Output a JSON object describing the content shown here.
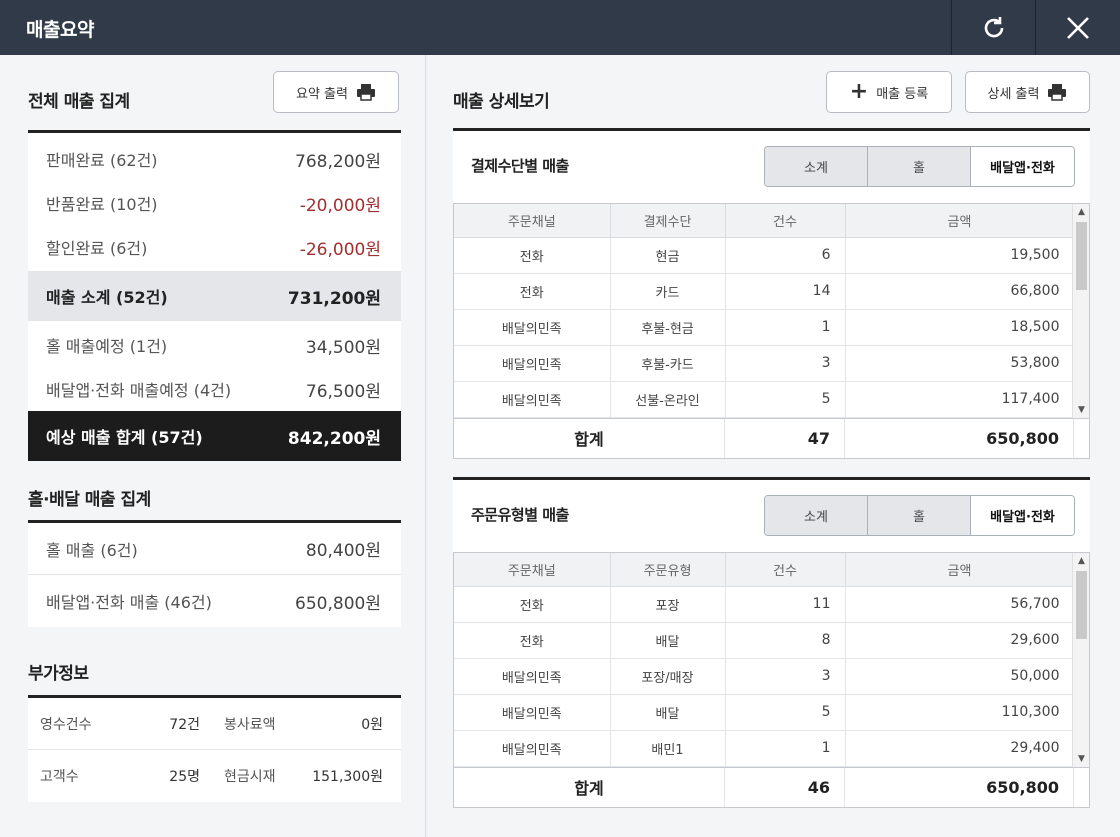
{
  "window": {
    "title": "매출요약"
  },
  "summary": {
    "title": "전체 매출 집계",
    "print_label": "요약 출력",
    "rows": [
      {
        "label": "판매완료 (62건)",
        "value": "768,200원"
      },
      {
        "label": "반품완료 (10건)",
        "value": "-20,000원"
      },
      {
        "label": "할인완료 (6건)",
        "value": "-26,000원"
      }
    ],
    "subtotal": {
      "label": "매출 소계 (52건)",
      "value": "731,200원"
    },
    "expected_rows": [
      {
        "label": "홀 매출예정 (1건)",
        "value": "34,500원"
      },
      {
        "label": "배달앱·전화 매출예정 (4건)",
        "value": "76,500원"
      }
    ],
    "total": {
      "label": "예상 매출 합계 (57건)",
      "value": "842,200원"
    }
  },
  "hall_delivery": {
    "title": "홀·배달 매출 집계",
    "rows": [
      {
        "label": "홀 매출 (6건)",
        "value": "80,400원"
      },
      {
        "label": "배달앱·전화 매출 (46건)",
        "value": "650,800원"
      }
    ]
  },
  "extra": {
    "title": "부가정보",
    "rows": [
      {
        "k1": "영수건수",
        "v1": "72건",
        "k2": "봉사료액",
        "v2": "0원"
      },
      {
        "k1": "고객수",
        "v1": "25명",
        "k2": "현금시재",
        "v2": "151,300원"
      }
    ]
  },
  "detail": {
    "title": "매출 상세보기",
    "register_label": "매출 등록",
    "print_label": "상세 출력"
  },
  "payment_panel": {
    "title": "결제수단별 매출",
    "segments": [
      "소계",
      "홀",
      "배달앱·전화"
    ],
    "headers": [
      "주문채널",
      "결제수단",
      "건수",
      "금액"
    ],
    "rows": [
      [
        "전화",
        "현금",
        "6",
        "19,500"
      ],
      [
        "전화",
        "카드",
        "14",
        "66,800"
      ],
      [
        "배달의민족",
        "후불-현금",
        "1",
        "18,500"
      ],
      [
        "배달의민족",
        "후불-카드",
        "3",
        "53,800"
      ],
      [
        "배달의민족",
        "선불-온라인",
        "5",
        "117,400"
      ]
    ],
    "footer": {
      "label": "합계",
      "count": "47",
      "amount": "650,800"
    }
  },
  "order_panel": {
    "title": "주문유형별 매출",
    "segments": [
      "소계",
      "홀",
      "배달앱·전화"
    ],
    "headers": [
      "주문채널",
      "주문유형",
      "건수",
      "금액"
    ],
    "rows": [
      [
        "전화",
        "포장",
        "11",
        "56,700"
      ],
      [
        "전화",
        "배달",
        "8",
        "29,600"
      ],
      [
        "배달의민족",
        "포장/매장",
        "3",
        "50,000"
      ],
      [
        "배달의민족",
        "배달",
        "5",
        "110,300"
      ],
      [
        "배달의민족",
        "배민1",
        "1",
        "29,400"
      ]
    ],
    "footer": {
      "label": "합계",
      "count": "46",
      "amount": "650,800"
    }
  },
  "colors": {
    "titlebar": "#313a48",
    "negative": "#a03030",
    "total_bg": "#1c1c1c"
  }
}
